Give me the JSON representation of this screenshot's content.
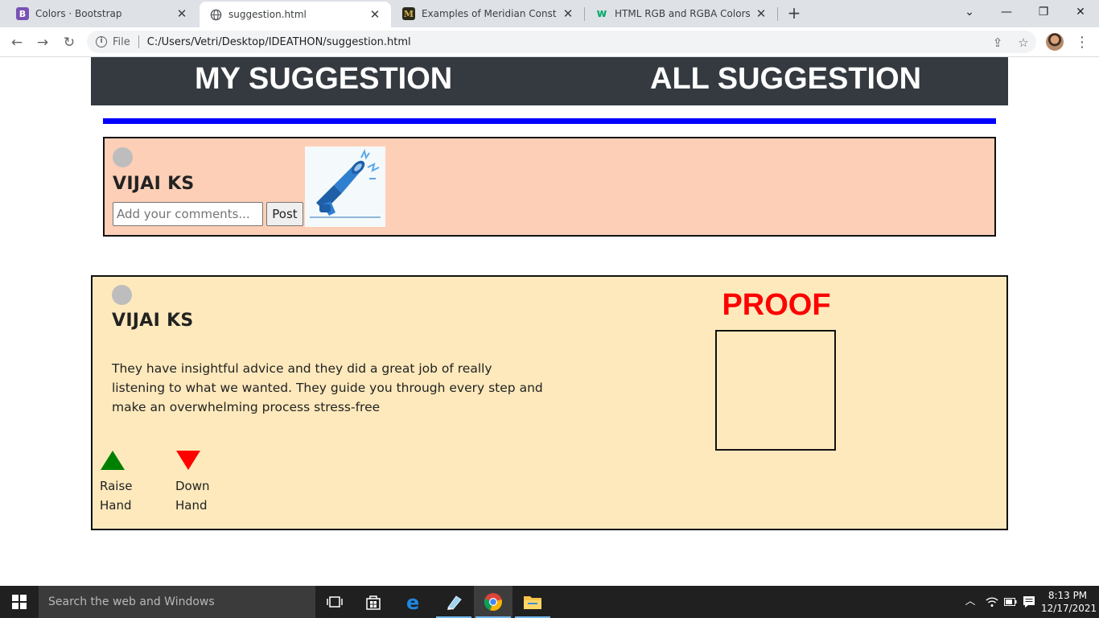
{
  "browser": {
    "tabs": [
      {
        "title": "Colors · Bootstrap",
        "favicon": "bootstrap-icon",
        "active": false
      },
      {
        "title": "suggestion.html",
        "favicon": "globe-icon",
        "active": true
      },
      {
        "title": "Examples of Meridian Constructio",
        "favicon": "meridian-m-icon",
        "active": false
      },
      {
        "title": "HTML RGB and RGBA Colors",
        "favicon": "w3schools-icon",
        "active": false
      }
    ],
    "address": {
      "scheme_label": "File",
      "url": "C:/Users/Vetri/Desktop/IDEATHON/suggestion.html"
    }
  },
  "page": {
    "nav": {
      "my_suggestion": "MY SUGGESTION",
      "all_suggestion": "ALL SUGGESTION"
    },
    "compose": {
      "user_name": "VIJAI KS",
      "comment_placeholder": "Add your comments...",
      "post_label": "Post",
      "image": "megaphone-icon"
    },
    "suggestion": {
      "user_name": "VIJAI KS",
      "text": "They have insightful advice and they did a great job of really listening to what we wanted. They guide you through every step and make an overwhelming process stress-free",
      "raise": {
        "line1": "Raise",
        "line2": "Hand",
        "icon": "triangle-up-icon",
        "color": "#008000"
      },
      "down": {
        "line1": "Down",
        "line2": "Hand",
        "icon": "triangle-down-icon",
        "color": "#ff0000"
      },
      "proof_title": "PROOF"
    },
    "colors": {
      "header_bg": "#343a40",
      "rule": "#0000ff",
      "compose_bg": "#fdcfb7",
      "card_bg": "#fde9bc",
      "proof": "#ff0000"
    }
  },
  "taskbar": {
    "search_placeholder": "Search the web and Windows",
    "time": "8:13 PM",
    "date": "12/17/2021"
  }
}
